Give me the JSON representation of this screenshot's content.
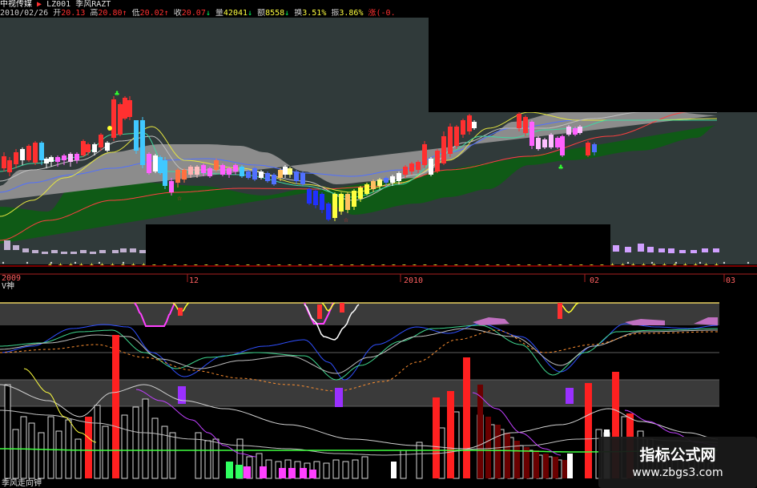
{
  "header": {
    "name": "中视传媒",
    "code_label": "LZ001",
    "formula": "季风RAZT",
    "date": "2010/02/26",
    "open_label": "开",
    "open": "20.13",
    "high_label": "高",
    "high": "20.80",
    "low_label": "低",
    "low": "20.02",
    "close_label": "收",
    "close": "20.07",
    "volume_label": "量",
    "volume": "42041",
    "amount_label": "额",
    "amount": "8558",
    "turnover_label": "换",
    "turnover": "3.51%",
    "amplitude_label": "振",
    "amplitude": "3.86%",
    "extra": "涨(-0."
  },
  "time_axis": {
    "labels": [
      "2009",
      "12",
      "2010",
      "02",
      "03"
    ]
  },
  "indicator_labels": {
    "lower_pane": "V神",
    "bottom_pane": "季风走向钾"
  },
  "watermark": {
    "title": "指标公式网",
    "url": "www.zbgs3.com"
  },
  "colors": {
    "up": "#ff3030",
    "down": "#00d8ff",
    "background": "#000000",
    "band_gray": "#8c8c8c",
    "band_green": "#0f5a16"
  }
}
